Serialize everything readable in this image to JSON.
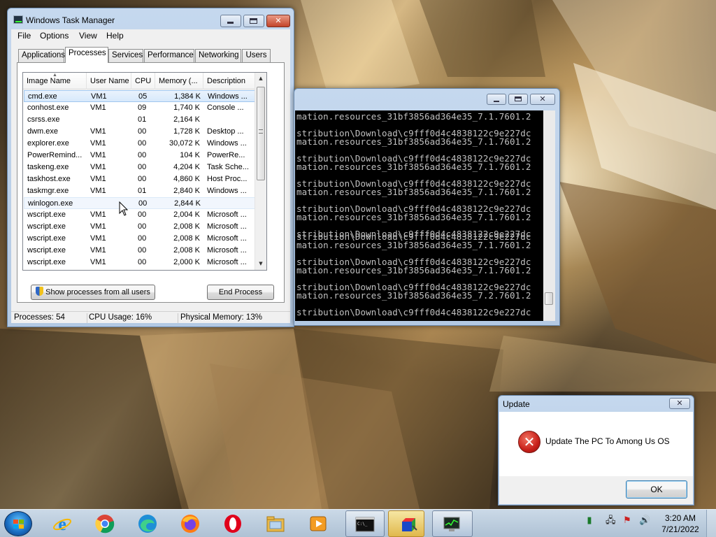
{
  "taskmgr": {
    "title": "Windows Task Manager",
    "menu": [
      "File",
      "Options",
      "View",
      "Help"
    ],
    "tabs": [
      "Applications",
      "Processes",
      "Services",
      "Performance",
      "Networking",
      "Users"
    ],
    "active_tab": "Processes",
    "columns": [
      "Image Name",
      "User Name",
      "CPU",
      "Memory (...",
      "Description"
    ],
    "rows": [
      {
        "name": "cmd.exe",
        "user": "VM1",
        "cpu": "05",
        "mem": "1,384 K",
        "desc": "Windows ..."
      },
      {
        "name": "conhost.exe",
        "user": "VM1",
        "cpu": "09",
        "mem": "1,740 K",
        "desc": "Console ..."
      },
      {
        "name": "csrss.exe",
        "user": "",
        "cpu": "01",
        "mem": "2,164 K",
        "desc": ""
      },
      {
        "name": "dwm.exe",
        "user": "VM1",
        "cpu": "00",
        "mem": "1,728 K",
        "desc": "Desktop ..."
      },
      {
        "name": "explorer.exe",
        "user": "VM1",
        "cpu": "00",
        "mem": "30,072 K",
        "desc": "Windows ..."
      },
      {
        "name": "PowerRemind...",
        "user": "VM1",
        "cpu": "00",
        "mem": "104 K",
        "desc": "PowerRe..."
      },
      {
        "name": "taskeng.exe",
        "user": "VM1",
        "cpu": "00",
        "mem": "4,204 K",
        "desc": "Task Sche..."
      },
      {
        "name": "taskhost.exe",
        "user": "VM1",
        "cpu": "00",
        "mem": "4,860 K",
        "desc": "Host Proc..."
      },
      {
        "name": "taskmgr.exe",
        "user": "VM1",
        "cpu": "01",
        "mem": "2,840 K",
        "desc": "Windows ..."
      },
      {
        "name": "winlogon.exe",
        "user": "",
        "cpu": "00",
        "mem": "2,844 K",
        "desc": ""
      },
      {
        "name": "wscript.exe",
        "user": "VM1",
        "cpu": "00",
        "mem": "2,004 K",
        "desc": "Microsoft ..."
      },
      {
        "name": "wscript.exe",
        "user": "VM1",
        "cpu": "00",
        "mem": "2,008 K",
        "desc": "Microsoft ..."
      },
      {
        "name": "wscript.exe",
        "user": "VM1",
        "cpu": "00",
        "mem": "2,008 K",
        "desc": "Microsoft ..."
      },
      {
        "name": "wscript.exe",
        "user": "VM1",
        "cpu": "00",
        "mem": "2,008 K",
        "desc": "Microsoft ..."
      },
      {
        "name": "wscript.exe",
        "user": "VM1",
        "cpu": "00",
        "mem": "2,000 K",
        "desc": "Microsoft ..."
      }
    ],
    "show_all_label": "Show processes from all users",
    "end_process_label": "End Process",
    "status": {
      "processes": "Processes: 54",
      "cpu": "CPU Usage: 16%",
      "memory": "Physical Memory: 13%"
    }
  },
  "console": {
    "lines": [
      "mation.resources_31bf3856ad364e35_7.1.7601.2",
      "",
      "stribution\\Download\\c9fff0d4c4838122c9e227dc",
      "mation.resources_31bf3856ad364e35_7.1.7601.2",
      "",
      "stribution\\Download\\c9fff0d4c4838122c9e227dc",
      "mation.resources_31bf3856ad364e35_7.1.7601.2",
      "",
      "stribution\\Download\\c9fff0d4c4838122c9e227dc",
      "mation.resources_31bf3856ad364e35_7.1.7601.2",
      "",
      "stribution\\Download\\c9fff0d4c4838122c9e227dc",
      "mation.resources_31bf3856ad364e35_7.1.7601.2",
      "",
      "stribution\\Download\\c9fff0d4c4838122c9e227dc",
      "stribution\\Download\\c9fff0d4c4838122c9e227dc",
      "mation.resources_31bf3856ad364e35_7.1.7601.2",
      "",
      "stribution\\Download\\c9fff0d4c4838122c9e227dc",
      "mation.resources_31bf3856ad364e35_7.1.7601.2",
      "",
      "stribution\\Download\\c9fff0d4c4838122c9e227dc",
      "mation.resources_31bf3856ad364e35_7.2.7601.2",
      "",
      "stribution\\Download\\c9fff0d4c4838122c9e227dc"
    ]
  },
  "update": {
    "title": "Update",
    "message": "Update The PC To Among Us OS",
    "ok_label": "OK"
  },
  "taskbar": {
    "clock_time": "3:20 AM",
    "clock_date": "7/21/2022",
    "pinned": [
      "internet-explorer-icon",
      "chrome-icon",
      "edge-icon",
      "firefox-icon",
      "opera-icon",
      "file-explorer-icon",
      "media-player-icon"
    ],
    "running": [
      "command-prompt-icon",
      "setup-app-icon",
      "task-manager-icon"
    ]
  },
  "colors": {
    "error_red": "#c8201a",
    "console_bg": "#000000",
    "console_text": "#c0c0c0",
    "selection": "#d7e9fb"
  }
}
